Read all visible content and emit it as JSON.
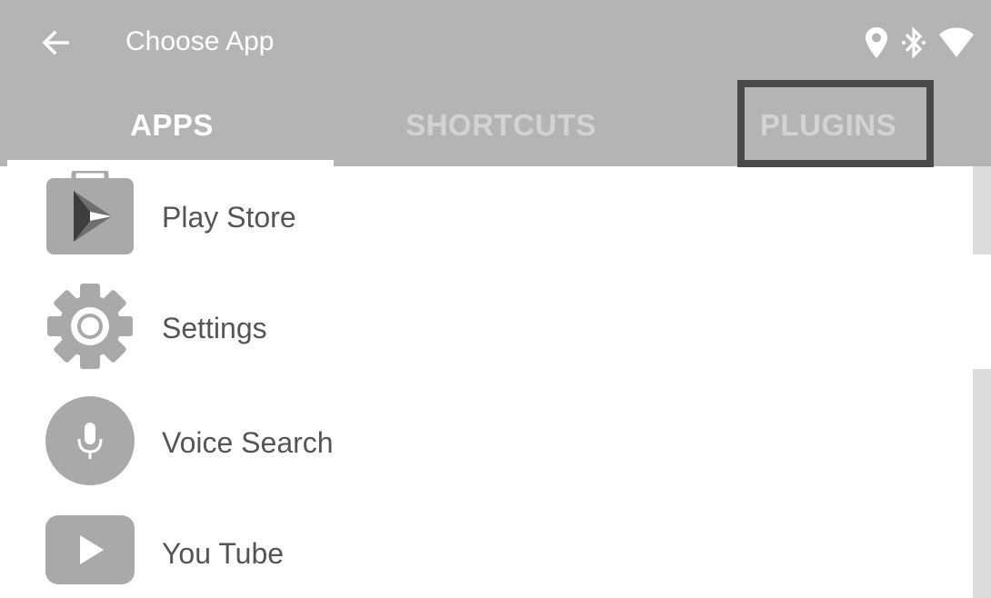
{
  "toolbar": {
    "title": "Choose App",
    "back_icon": "arrow-left-icon",
    "status_icons": [
      "location-pin-icon",
      "bluetooth-icon",
      "wifi-icon"
    ]
  },
  "tabs": [
    {
      "label": "APPS",
      "selected": true
    },
    {
      "label": "SHORTCUTS",
      "selected": false
    },
    {
      "label": "PLUGINS",
      "selected": false
    }
  ],
  "apps": [
    {
      "label": "Play Store",
      "icon": "play-store-icon"
    },
    {
      "label": "Settings",
      "icon": "settings-gear-icon"
    },
    {
      "label": "Voice Search",
      "icon": "microphone-icon"
    },
    {
      "label": "You Tube",
      "icon": "youtube-icon"
    }
  ],
  "colors": {
    "header_bg": "#b4b4b4",
    "tab_selected": "#ffffff",
    "tab_unselected": "#d3d3d3",
    "highlight_border": "#4a4a4a",
    "icon_gray": "#a9a9a9",
    "text": "#555555"
  }
}
